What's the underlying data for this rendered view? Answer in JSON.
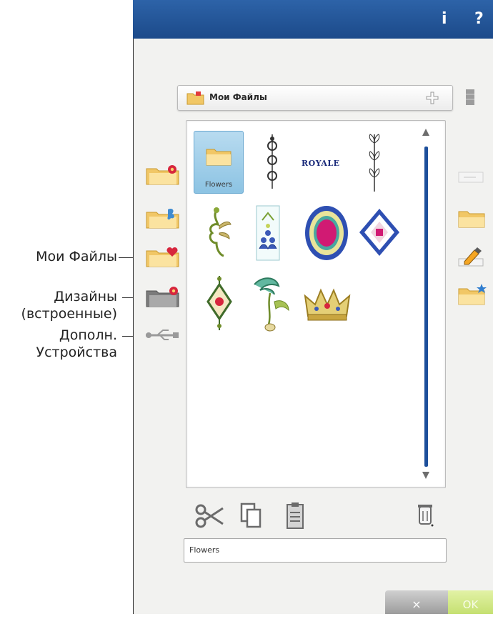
{
  "header": {
    "info_label": "i",
    "help_label": "?"
  },
  "folder_selector": {
    "current_folder": "Мои Файлы"
  },
  "file_browser": {
    "items": [
      {
        "type": "folder",
        "label": "Flowers",
        "selected": true
      },
      {
        "type": "design",
        "icon": "vertical-border-design-icon"
      },
      {
        "type": "design",
        "text": "ROYALE"
      },
      {
        "type": "design",
        "icon": "leaf-stem-design-icon"
      },
      {
        "type": "design",
        "icon": "flourish-design-icon"
      },
      {
        "type": "design",
        "icon": "scalloped-border-design-icon"
      },
      {
        "type": "design",
        "icon": "oval-frame-design-icon"
      },
      {
        "type": "design",
        "icon": "diamond-frame-design-icon"
      },
      {
        "type": "design",
        "icon": "diamond-ornament-design-icon"
      },
      {
        "type": "design",
        "icon": "feather-design-icon"
      },
      {
        "type": "design",
        "icon": "crown-design-icon"
      }
    ]
  },
  "file_name_field": {
    "value": "Flowers"
  },
  "buttons": {
    "cancel_label": "×",
    "ok_label": "OK"
  },
  "callouts": {
    "my_files": "Мои Файлы",
    "designs_line1": "Дизайны",
    "designs_line2": "(встроенные)",
    "devices_line1": "Дополн.",
    "devices_line2": "Устройства"
  },
  "colors": {
    "title_bar": "#1f4f92",
    "scrollbar": "#1d4f9b",
    "ok_button": "#c5e071"
  }
}
